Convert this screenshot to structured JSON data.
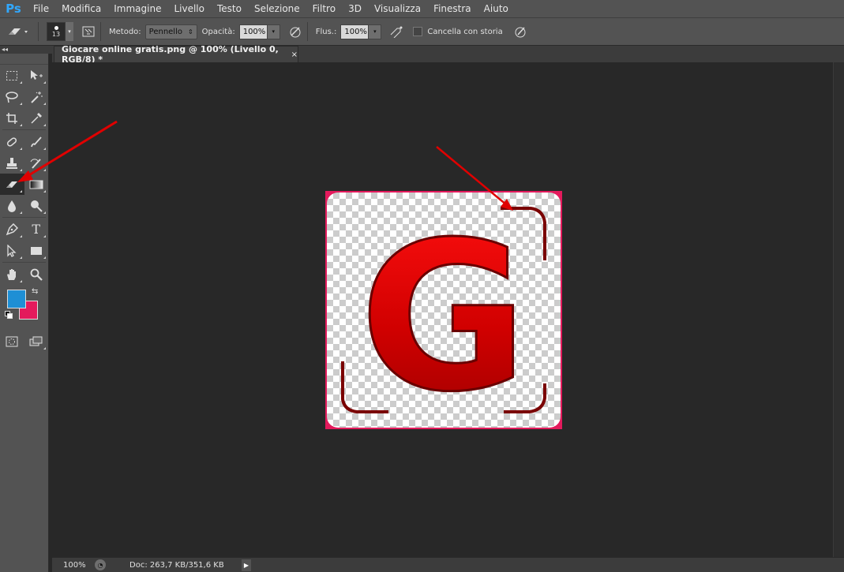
{
  "app": {
    "logo": "Ps"
  },
  "menu": [
    "File",
    "Modifica",
    "Immagine",
    "Livello",
    "Testo",
    "Selezione",
    "Filtro",
    "3D",
    "Visualizza",
    "Finestra",
    "Aiuto"
  ],
  "options": {
    "brush_size": "13",
    "mode_label": "Metodo:",
    "mode_value": "Pennello",
    "opacity_label": "Opacità:",
    "opacity_value": "100%",
    "flow_label": "Flus.:",
    "flow_value": "100%",
    "erase_history_label": "Cancella con storia"
  },
  "document_tab": {
    "title": "Giocare online gratis.png @ 100% (Livello 0, RGB/8) *",
    "close": "×"
  },
  "colors": {
    "foreground": "#1e8fd5",
    "background": "#e31a5c",
    "accent_red": "#e00000",
    "doc_border": "#e31a5c"
  },
  "canvas": {
    "letter": "G"
  },
  "status": {
    "zoom": "100%",
    "doc_info": "Doc: 263,7 KB/351,6 KB"
  },
  "toolbar_collapse": "◂◂"
}
